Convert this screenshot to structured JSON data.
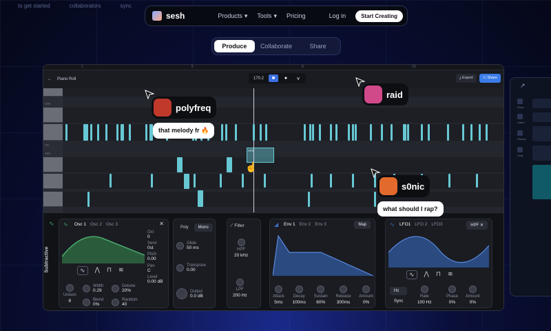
{
  "ghost_nav": [
    "to get started",
    "collaborators",
    "sync"
  ],
  "nav": {
    "brand": "sesh",
    "links": [
      {
        "label": "Products",
        "dropdown": true
      },
      {
        "label": "Tools",
        "dropdown": true
      },
      {
        "label": "Pricing",
        "dropdown": false
      }
    ],
    "login": "Log in",
    "cta": "Start Creating"
  },
  "segments": [
    {
      "label": "Produce",
      "active": true
    },
    {
      "label": "Collaborate",
      "active": false
    },
    {
      "label": "Share",
      "active": false
    }
  ],
  "daw": {
    "ruler": [
      "1",
      "5",
      "9",
      "13"
    ],
    "title": "Piano Roll",
    "bpm": "170.2",
    "export": "Export",
    "share": "Share",
    "key_labels": [
      "C#5",
      "C5",
      "A#4",
      "G4"
    ],
    "selected_note_label": "A#4"
  },
  "collaborators": [
    {
      "name": "polyfreq",
      "message": "that melody fr 🔥",
      "avatar_color": "#c0392b"
    },
    {
      "name": "raid",
      "message": "",
      "avatar_color": "#d04a8a"
    },
    {
      "name": "s0nic",
      "message": "what should I rap?",
      "avatar_color": "#e26a2c"
    }
  ],
  "synth": {
    "section_label": "Subtractive",
    "osc": {
      "tabs": [
        "Osc 1",
        "Osc 2",
        "Osc 3"
      ],
      "params": [
        {
          "label": "Oct",
          "value": "0"
        },
        {
          "label": "Semi",
          "value": "0st"
        },
        {
          "label": "Pitch",
          "value": "0.00"
        },
        {
          "label": "Pan",
          "value": "C"
        },
        {
          "label": "Level",
          "value": "0.00 dB"
        }
      ],
      "knobs": [
        {
          "label": "Unison",
          "value": "8"
        },
        {
          "label": "Width",
          "value": "0.29"
        },
        {
          "label": "Blend",
          "value": "0%"
        },
        {
          "label": "Detune",
          "value": "20%"
        },
        {
          "label": "Random",
          "value": "40"
        }
      ]
    },
    "voice": {
      "modes": [
        "Poly",
        "Mono"
      ],
      "glide": {
        "label": "Glide",
        "value": "50 ms"
      },
      "transpose": {
        "label": "Transpose",
        "value": "0.00"
      },
      "output": {
        "label": "Output",
        "value": "0.0 dB"
      }
    },
    "filter": {
      "title": "Filter",
      "hpf": {
        "label": "HPF",
        "value": "20 kHz"
      },
      "lpf": {
        "label": "LPF",
        "value": "200 Hz"
      }
    },
    "env": {
      "tabs": [
        "Env 1",
        "Env 2",
        "Env 3"
      ],
      "map": "Map",
      "params": [
        {
          "label": "Attack",
          "value": "5ms"
        },
        {
          "label": "Decay",
          "value": "100ms"
        },
        {
          "label": "Sustain",
          "value": "60%"
        },
        {
          "label": "Release",
          "value": "300ms"
        },
        {
          "label": "Amount",
          "value": "0%"
        }
      ]
    },
    "lfo": {
      "tabs": [
        "LFO1",
        "LFO 2",
        "LFO3"
      ],
      "target": "HPF",
      "hz": "Hz",
      "sync": "Sync",
      "params": [
        {
          "label": "Rate",
          "value": "100 Hz"
        },
        {
          "label": "Phase",
          "value": "0%"
        },
        {
          "label": "Amount",
          "value": "0%"
        }
      ]
    }
  },
  "side_panel": {
    "items": [
      "Draw",
      "Listen",
      "History",
      "Chat"
    ]
  },
  "colors": {
    "accent": "#3b6fe0",
    "note": "#67c8d4",
    "wave_green": "#4aa86a",
    "lfo_blue": "#3d6fc0"
  }
}
